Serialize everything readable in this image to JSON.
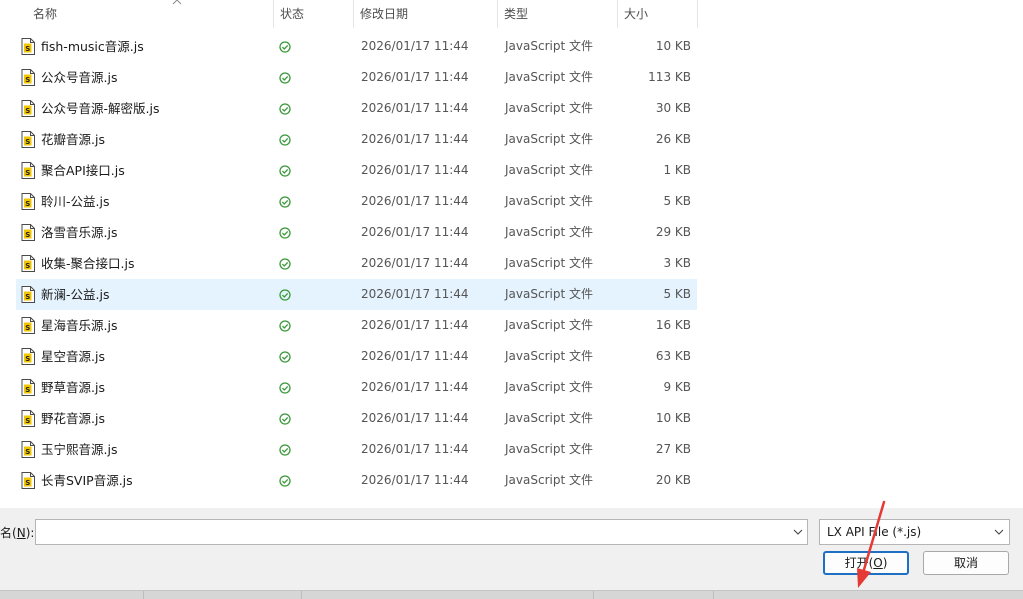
{
  "columns": {
    "name": "名称",
    "status": "状态",
    "date": "修改日期",
    "type": "类型",
    "size": "大小"
  },
  "files": [
    {
      "name": "fish-music音源.js",
      "date": "2026/01/17 11:44",
      "type": "JavaScript 文件",
      "size": "10 KB"
    },
    {
      "name": "公众号音源.js",
      "date": "2026/01/17 11:44",
      "type": "JavaScript 文件",
      "size": "113 KB"
    },
    {
      "name": "公众号音源-解密版.js",
      "date": "2026/01/17 11:44",
      "type": "JavaScript 文件",
      "size": "30 KB"
    },
    {
      "name": "花瓣音源.js",
      "date": "2026/01/17 11:44",
      "type": "JavaScript 文件",
      "size": "26 KB"
    },
    {
      "name": "聚合API接口.js",
      "date": "2026/01/17 11:44",
      "type": "JavaScript 文件",
      "size": "1 KB"
    },
    {
      "name": "聆川-公益.js",
      "date": "2026/01/17 11:44",
      "type": "JavaScript 文件",
      "size": "5 KB"
    },
    {
      "name": "洛雪音乐源.js",
      "date": "2026/01/17 11:44",
      "type": "JavaScript 文件",
      "size": "29 KB"
    },
    {
      "name": "收集-聚合接口.js",
      "date": "2026/01/17 11:44",
      "type": "JavaScript 文件",
      "size": "3 KB"
    },
    {
      "name": "新澜-公益.js",
      "date": "2026/01/17 11:44",
      "type": "JavaScript 文件",
      "size": "5 KB",
      "selected": true
    },
    {
      "name": "星海音乐源.js",
      "date": "2026/01/17 11:44",
      "type": "JavaScript 文件",
      "size": "16 KB"
    },
    {
      "name": "星空音源.js",
      "date": "2026/01/17 11:44",
      "type": "JavaScript 文件",
      "size": "63 KB"
    },
    {
      "name": "野草音源.js",
      "date": "2026/01/17 11:44",
      "type": "JavaScript 文件",
      "size": "9 KB"
    },
    {
      "name": "野花音源.js",
      "date": "2026/01/17 11:44",
      "type": "JavaScript 文件",
      "size": "10 KB"
    },
    {
      "name": "玉宁熙音源.js",
      "date": "2026/01/17 11:44",
      "type": "JavaScript 文件",
      "size": "27 KB"
    },
    {
      "name": "长青SVIP音源.js",
      "date": "2026/01/17 11:44",
      "type": "JavaScript 文件",
      "size": "20 KB"
    }
  ],
  "file_icon": "javascript-file-icon",
  "status_icon": "sync-check-icon",
  "footer": {
    "filename_label": "名",
    "filename_hotkey": "N",
    "filename_value": "",
    "filter_value": "LX API File (*.js)",
    "open_label": "打开",
    "open_hotkey": "O",
    "cancel_label": "取消"
  },
  "colors": {
    "selection": "#e5f3ff",
    "status_green": "#3a9a3a",
    "default_button_border": "#1f6fc5",
    "annotation_arrow": "#e53935"
  }
}
